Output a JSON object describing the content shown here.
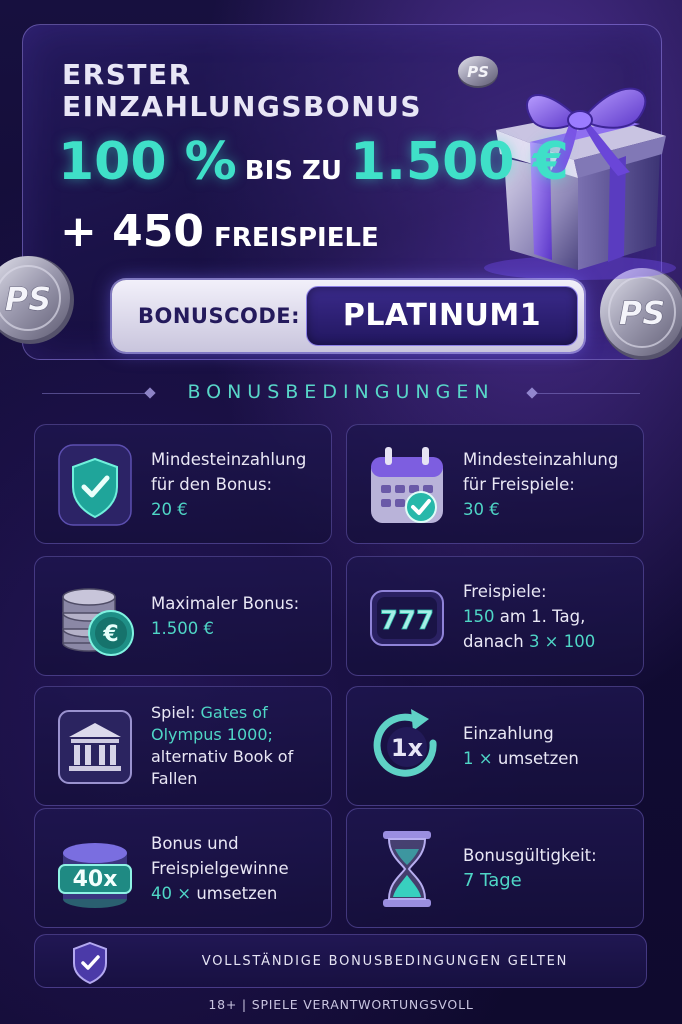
{
  "hero": {
    "line1": "ERSTER",
    "line2": "EINZAHLUNGSBONUS",
    "percent": "100 %",
    "up_to": "BIS ZU",
    "max_amount": "1.500 €",
    "spins_count": "+ 450",
    "spins_label": "FREISPIELE"
  },
  "bonus_code": {
    "label": "BONUSCODE:",
    "value": "PLATINUM1"
  },
  "section_title": "BONUSBEDINGUNGEN",
  "cards": [
    {
      "icon": "shield-check-icon",
      "line1": "Mindesteinzahlung",
      "line2": "für den Bonus:",
      "value": "20 €"
    },
    {
      "icon": "calendar-check-icon",
      "line1": "Mindesteinzahlung",
      "line2": "für Freispiele:",
      "value": "30 €"
    },
    {
      "icon": "euro-coins-icon",
      "line1": "Maximaler Bonus:",
      "value": "1.500 €"
    },
    {
      "icon": "slot-777-icon",
      "line1": "Freispiele:",
      "line2_teal": "150",
      "line2_rest": " am 1. Tag,",
      "line3_prefix": "danach ",
      "line3_teal": "3 × 100",
      "badge": "777"
    },
    {
      "icon": "temple-icon",
      "prefix": "Spiel: ",
      "game_teal": "Gates of Olympus 1000;",
      "rest": "alternativ Book of Fallen"
    },
    {
      "icon": "rotate-1x-icon",
      "line1": "Einzahlung",
      "value_teal": "1 ×",
      "value_rest": " umsetzen",
      "badge": "1x"
    },
    {
      "icon": "coin-stack-40x-icon",
      "line1": "Bonus und",
      "line2": "Freispielgewinne",
      "value_teal": "40 ×",
      "value_rest": " umsetzen",
      "badge": "40x"
    },
    {
      "icon": "hourglass-icon",
      "line1": "Bonusgültigkeit:",
      "value": "7 Tage"
    }
  ],
  "footer": {
    "notice": "VOLLSTÄNDIGE BONUSBEDINGUNGEN GELTEN",
    "legal": "18+ | SPIELE VERANTWORTUNGSVOLL"
  },
  "coin_text": "PS",
  "colors": {
    "accent_teal": "#3fe0c8",
    "background": "#140d3a",
    "code_box": "#2a1d72"
  }
}
